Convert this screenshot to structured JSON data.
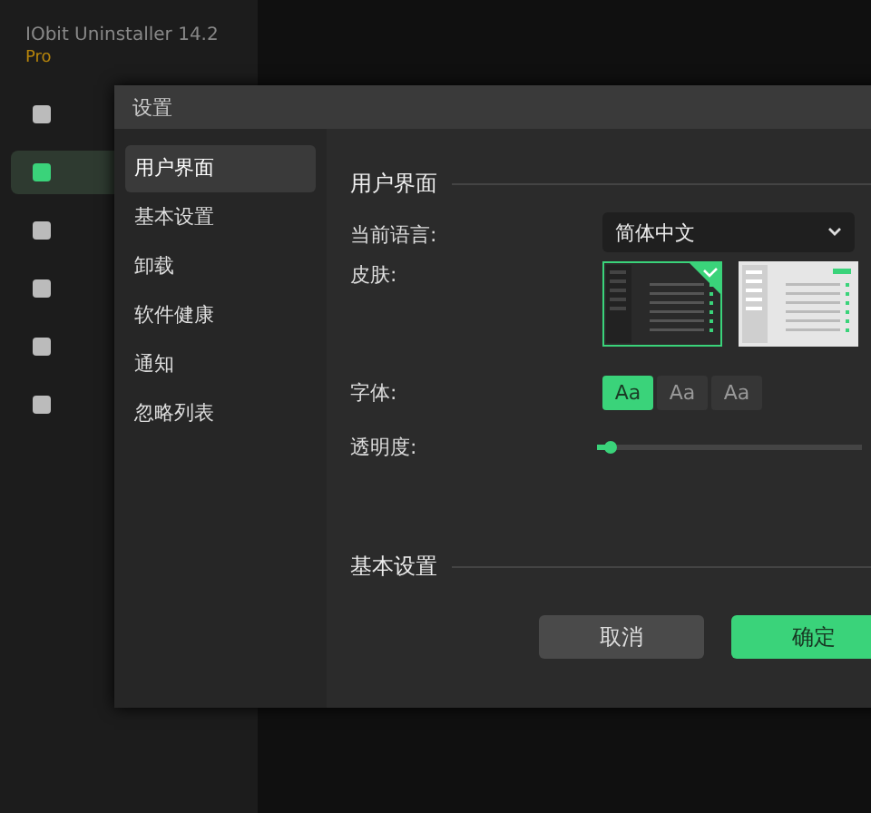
{
  "app": {
    "title": "IObit Uninstaller 14.2",
    "edition": "Pro"
  },
  "dialog": {
    "title": "设置",
    "nav": [
      {
        "label": "用户界面",
        "selected": true
      },
      {
        "label": "基本设置",
        "selected": false
      },
      {
        "label": "卸载",
        "selected": false
      },
      {
        "label": "软件健康",
        "selected": false
      },
      {
        "label": "通知",
        "selected": false
      },
      {
        "label": "忽略列表",
        "selected": false
      }
    ],
    "section": "用户界面",
    "language": {
      "label": "当前语言:",
      "value": "简体中文"
    },
    "skin": {
      "label": "皮肤:",
      "options": [
        {
          "kind": "dark",
          "selected": true
        },
        {
          "kind": "light",
          "selected": false
        }
      ]
    },
    "font": {
      "label": "字体:",
      "options": [
        {
          "label": "Aa",
          "selected": true
        },
        {
          "label": "Aa",
          "selected": false
        },
        {
          "label": "Aa",
          "selected": false
        }
      ]
    },
    "opacity": {
      "label": "透明度:",
      "level": 0.05
    },
    "next_section": "基本设置",
    "buttons": [
      {
        "label": "取消",
        "kind": "secondary"
      },
      {
        "label": "确定",
        "kind": "primary"
      }
    ]
  }
}
